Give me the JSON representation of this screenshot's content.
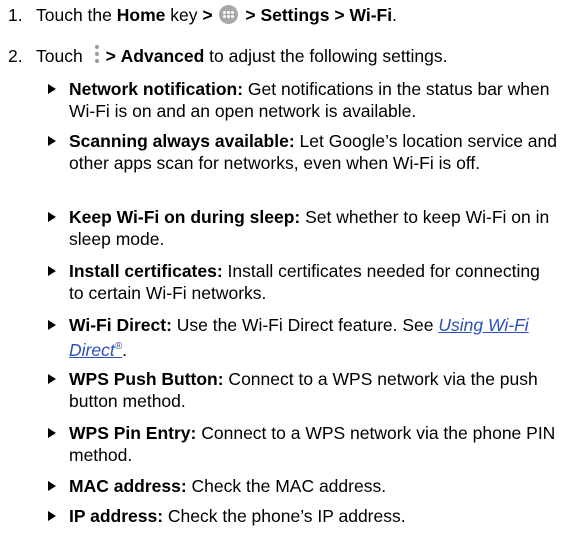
{
  "steps": [
    {
      "number": "1.",
      "prefix": "Touch the ",
      "home_key": "Home",
      "key_suffix": " key ",
      "separator": ">",
      "settings": "Settings",
      "wifi": "Wi-Fi",
      "period": ".",
      "icon": "apps-grid-icon"
    },
    {
      "number": "2.",
      "prefix": "Touch ",
      "icon": "menu-vertical-dots-icon",
      "separator": ">",
      "advanced": "Advanced",
      "suffix": " to adjust the following settings."
    }
  ],
  "settings_list": [
    {
      "term": "Network notification:",
      "description": " Get notifications in the status bar when Wi-Fi is on and an open network is available."
    },
    {
      "term": "Scanning always available:",
      "description": " Let Google’s location service and other apps scan for networks, even when Wi-Fi is off."
    },
    {
      "term": "Keep Wi-Fi on during sleep:",
      "description": " Set whether to keep Wi-Fi on in sleep mode."
    },
    {
      "term": "Install certificates:",
      "description": " Install certificates needed for connecting to certain Wi-Fi networks."
    },
    {
      "term": "Wi-Fi Direct:",
      "description": " Use the Wi-Fi Direct feature. See ",
      "link_text": "Using Wi-Fi Direct",
      "link_sup": "®",
      "tail": "."
    },
    {
      "term": "WPS Push Button:",
      "description": " Connect to a WPS network via the push button method."
    },
    {
      "term": "WPS Pin Entry:",
      "description": " Connect to a WPS network via the phone PIN method."
    },
    {
      "term": "MAC address:",
      "description": " Check the MAC address."
    },
    {
      "term": "IP address:",
      "description": " Check the phone’s IP address."
    }
  ],
  "colors": {
    "text": "#000000",
    "link": "#2b4fb8",
    "icon": "#a8a8a8"
  }
}
